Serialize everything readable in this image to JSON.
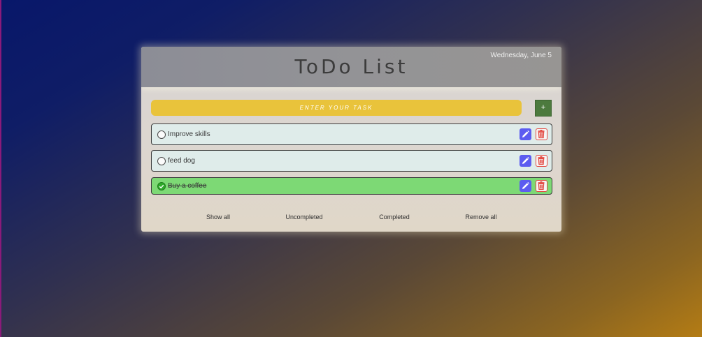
{
  "app": {
    "title": "ToDo List",
    "date": "Wednesday, June 5"
  },
  "input": {
    "placeholder": "ENTER YOUR TASK",
    "value": ""
  },
  "add_button": {
    "label": "+"
  },
  "tasks": [
    {
      "label": "Improve skills",
      "completed": false
    },
    {
      "label": "feed dog",
      "completed": false
    },
    {
      "label": "Buy a coffee",
      "completed": true
    }
  ],
  "icons": {
    "edit": "pencil-icon",
    "delete": "trash-icon",
    "check": "checkmark-icon"
  },
  "filters": {
    "show_all": "Show all",
    "uncompleted": "Uncompleted",
    "completed": "Completed",
    "remove_all": "Remove all"
  },
  "colors": {
    "input_bg": "#e9c33b",
    "add_button_bg": "#4c7a3e",
    "task_bg": "#dfecea",
    "task_done_bg": "#7dd975",
    "edit_bg": "#5c5cf0",
    "delete_accent": "#e3473f"
  }
}
